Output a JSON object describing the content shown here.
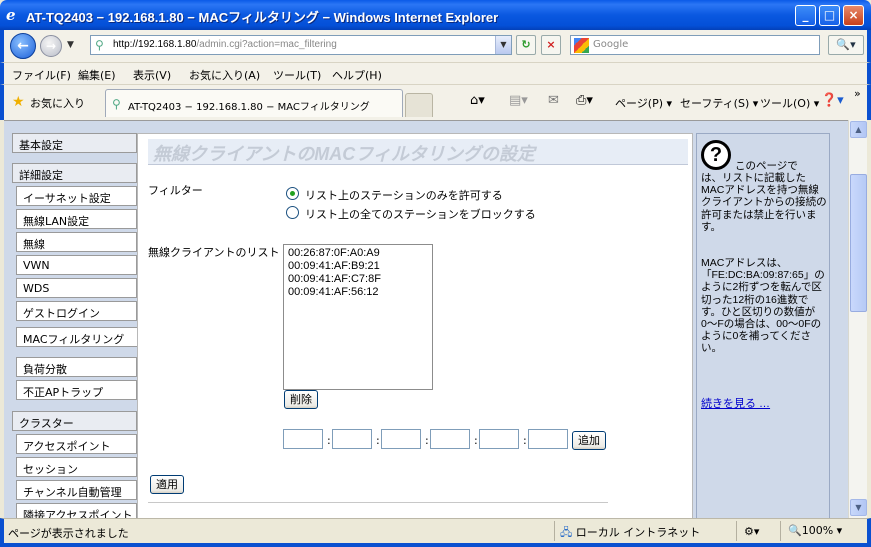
{
  "window": {
    "title": "AT-TQ2403 − 192.168.1.80 − MACフィルタリング − Windows Internet Explorer",
    "title_icon": "e",
    "min_glyph": "_",
    "max_glyph": "□",
    "close_glyph": "×"
  },
  "address": {
    "url_host": "http://192.168.1.80",
    "url_path": "/admin.cgi?action=mac_filtering",
    "search_placeholder": "Google",
    "back_glyph": "←",
    "fwd_glyph": "→",
    "refresh_glyph": "↻",
    "stop_glyph": "×",
    "search_btn_glyph": "🔍▾"
  },
  "menubar": {
    "items": [
      "ファイル(F)",
      "編集(E)",
      "表示(V)",
      "お気に入り(A)",
      "ツール(T)",
      "ヘルプ(H)"
    ]
  },
  "tabbar": {
    "favorites_label": "お気に入り",
    "tab_title": "AT-TQ2403 − 192.168.1.80 − MACフィルタリング",
    "page_cmd": "ページ(P) ▾",
    "safety_cmd": "セーフティ(S) ▾",
    "tools_cmd": "ツール(O) ▾",
    "overflow": "»"
  },
  "sidebar": {
    "basic": "基本設定",
    "advanced": "詳細設定",
    "items": [
      "イーサネット設定",
      "無線LAN設定",
      "無線",
      "VWN",
      "WDS",
      "ゲストログイン",
      "MACフィルタリング",
      "負荷分散",
      "不正APトラップ"
    ],
    "cluster": "クラスター",
    "cluster_items": [
      "アクセスポイント",
      "セッション",
      "チャンネル自動管理",
      "隣接アクセスポイント"
    ]
  },
  "main": {
    "title": "無線クライアントのMACフィルタリングの設定",
    "filter_label": "フィルター",
    "radio_allow": "リスト上のステーションのみを許可する",
    "radio_block": "リスト上の全てのステーションをブロックする",
    "list_label": "無線クライアントのリスト",
    "clients": [
      "00:26:87:0F:A0:A9",
      "00:09:41:AF:B9:21",
      "00:09:41:AF:C7:8F",
      "00:09:41:AF:56:12"
    ],
    "delete_button": "削除",
    "add_button": "追加",
    "apply_button": "適用",
    "colon": ":",
    "selected_filter": "allow"
  },
  "help": {
    "intro": "このページでは、リストに記載したMACアドレスを持つ無線クライアントからの接続の許可または禁止を行います。",
    "line1": "このページで",
    "rest": "は、リストに記載したMACアドレスを持つ無線クライアントからの接続の許可または禁止を行います。",
    "format": "MACアドレスは、「FE:DC:BA:09:87:65」のように2桁ずつを転んで区切った12桁の16進数です。ひと区切りの数値が0〜Fの場合は、00〜0Fのように0を補ってください。",
    "more_link": "続きを見る …"
  },
  "status": {
    "text": "ページが表示されました",
    "zone": "ローカル イントラネット",
    "zoom": "100% ▾"
  }
}
